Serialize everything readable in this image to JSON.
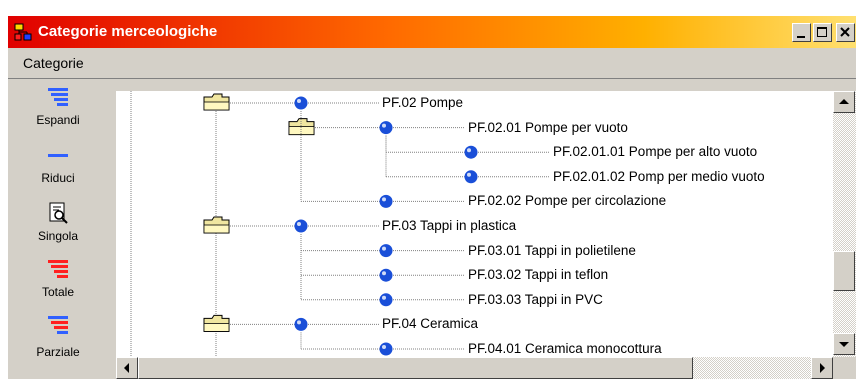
{
  "window": {
    "title": "Categorie merceologiche",
    "title_color": "#ffffff"
  },
  "menubar": {
    "items": [
      {
        "label": "Categorie"
      }
    ]
  },
  "toolbar": {
    "items": [
      {
        "label": "Espandi",
        "icon": "expand-icon"
      },
      {
        "label": "Riduci",
        "icon": "collapse-icon"
      },
      {
        "label": "Singola",
        "icon": "single-view-icon"
      },
      {
        "label": "Totale",
        "icon": "total-icon"
      },
      {
        "label": "Parziale",
        "icon": "partial-icon"
      }
    ]
  },
  "tree": {
    "nodes": [
      {
        "text": "PF.02  Pompe",
        "level": 1,
        "folder": true
      },
      {
        "text": "PF.02.01  Pompe per vuoto",
        "level": 2,
        "folder": true
      },
      {
        "text": "PF.02.01.01  Pompe per alto vuoto",
        "level": 3,
        "folder": false
      },
      {
        "text": "PF.02.01.02  Pomp per medio vuoto",
        "level": 3,
        "folder": false
      },
      {
        "text": "PF.02.02  Pompe per circolazione",
        "level": 2,
        "folder": false
      },
      {
        "text": "PF.03  Tappi in plastica",
        "level": 1,
        "folder": true
      },
      {
        "text": "PF.03.01  Tappi in polietilene",
        "level": 2,
        "folder": false
      },
      {
        "text": "PF.03.02  Tappi in teflon",
        "level": 2,
        "folder": false
      },
      {
        "text": "PF.03.03  Tappi in PVC",
        "level": 2,
        "folder": false
      },
      {
        "text": "PF.04  Ceramica",
        "level": 1,
        "folder": true
      },
      {
        "text": "PF.04.01  Ceramica monocottura",
        "level": 2,
        "folder": false
      }
    ]
  },
  "colors": {
    "title_gradient_start": "#e00000",
    "title_gradient_end": "#ffe070",
    "node_ball": "#1a4fd8",
    "folder": "#f0e6a0"
  }
}
